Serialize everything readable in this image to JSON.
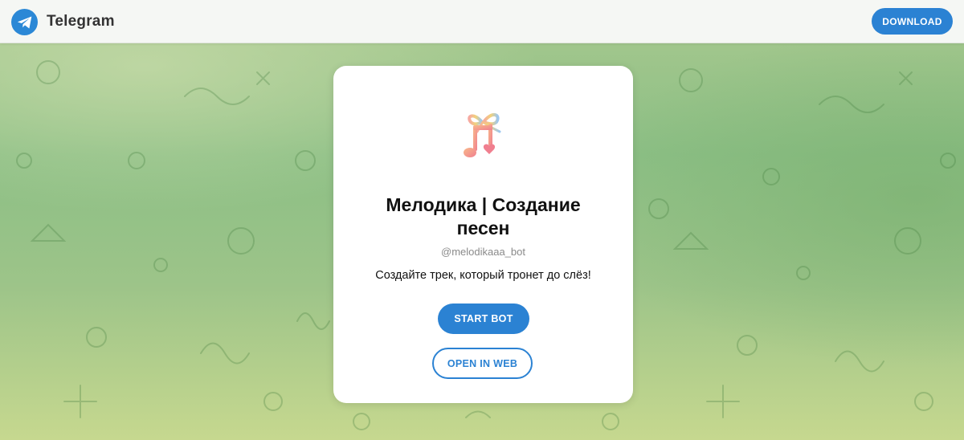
{
  "header": {
    "brand": "Telegram",
    "download_label": "DOWNLOAD",
    "logo_icon": "telegram-plane-icon"
  },
  "bot": {
    "title": "Мелодика | Создание песен",
    "username": "@melodikaaa_bot",
    "description": "Создайте трек, который тронет до слёз!",
    "avatar_icon": "music-note-bow-icon",
    "start_label": "START BOT",
    "web_label": "OPEN IN WEB"
  },
  "colors": {
    "accent": "#2b82d3",
    "background_green": "#8cbf85",
    "card": "#ffffff"
  }
}
